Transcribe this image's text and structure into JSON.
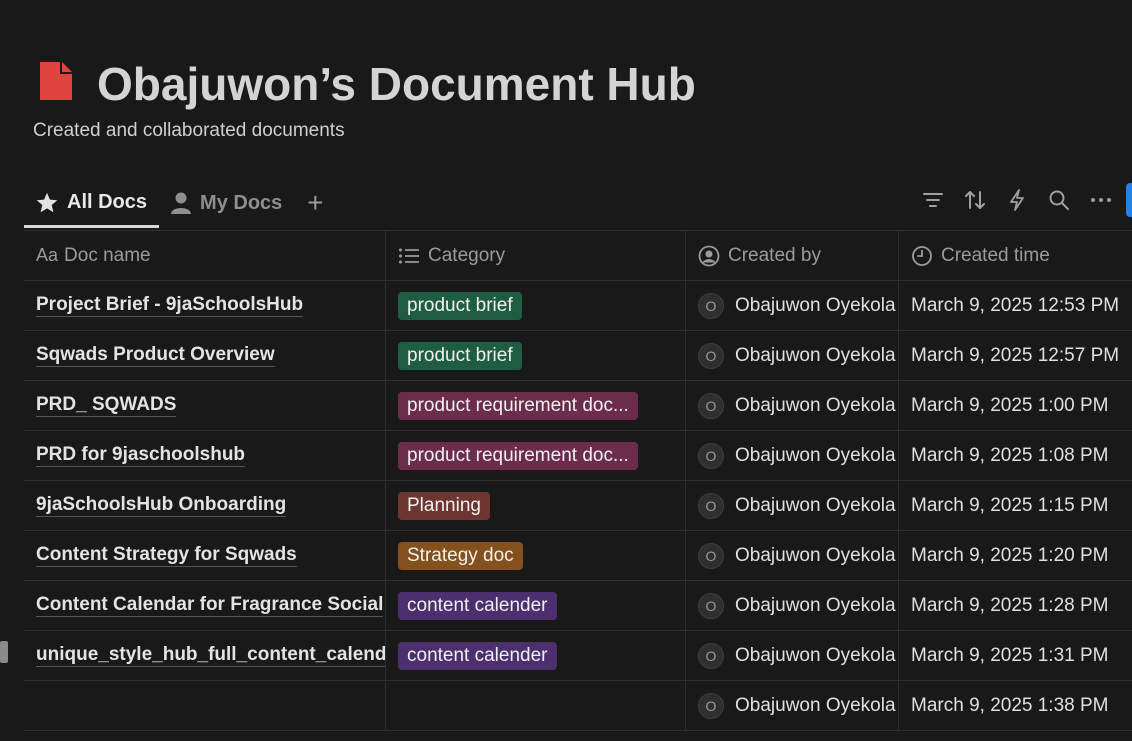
{
  "page": {
    "title": "Obajuwon’s Document Hub",
    "subtitle": "Created and collaborated documents",
    "icon": "document-icon",
    "icon_color": "#e0443f"
  },
  "tabs": [
    {
      "label": "All Docs",
      "icon": "star-icon",
      "active": true
    },
    {
      "label": "My Docs",
      "icon": "person-icon",
      "active": false
    }
  ],
  "add_tab_label": "+",
  "toolbar": [
    "filter-icon",
    "sort-icon",
    "automation-icon",
    "search-icon",
    "more-icon"
  ],
  "columns": [
    {
      "label": "Doc name",
      "prefix": "Aa"
    },
    {
      "label": "Category",
      "icon": "list-icon"
    },
    {
      "label": "Created by",
      "icon": "user-circle-icon"
    },
    {
      "label": "Created time",
      "icon": "clock-icon"
    }
  ],
  "tag_colors": {
    "product brief": "#1f5d42",
    "product requirement doc...": "#6c2d4d",
    "Planning": "#6e3630",
    "Strategy doc": "#84501b",
    "content calender": "#4b2f6e"
  },
  "rows": [
    {
      "name": "Project Brief - 9jaSchoolsHub",
      "category": "product brief",
      "avatar": "O",
      "created_by": "Obajuwon Oyekola",
      "created_time": "March 9, 2025 12:53 PM"
    },
    {
      "name": "Sqwads Product Overview",
      "category": "product brief",
      "avatar": "O",
      "created_by": "Obajuwon Oyekola",
      "created_time": "March 9, 2025 12:57 PM"
    },
    {
      "name": "PRD_ SQWADS",
      "category": "product requirement doc...",
      "avatar": "O",
      "created_by": "Obajuwon Oyekola",
      "created_time": "March 9, 2025 1:00 PM"
    },
    {
      "name": "PRD for 9jaschoolshub",
      "category": "product requirement doc...",
      "avatar": "O",
      "created_by": "Obajuwon Oyekola",
      "created_time": "March 9, 2025 1:08 PM"
    },
    {
      "name": "9jaSchoolsHub Onboarding",
      "category": "Planning",
      "avatar": "O",
      "created_by": "Obajuwon Oyekola",
      "created_time": "March 9, 2025 1:15 PM"
    },
    {
      "name": "Content Strategy for Sqwads",
      "category": "Strategy doc",
      "avatar": "O",
      "created_by": "Obajuwon Oyekola",
      "created_time": "March 9, 2025 1:20 PM"
    },
    {
      "name": "Content Calendar for Fragrance Social",
      "category": "content calender",
      "avatar": "O",
      "created_by": "Obajuwon Oyekola",
      "created_time": "March 9, 2025 1:28 PM"
    },
    {
      "name": "unique_style_hub_full_content_calendar",
      "category": "content calender",
      "avatar": "O",
      "created_by": "Obajuwon Oyekola",
      "created_time": "March 9, 2025 1:31 PM"
    },
    {
      "name": "",
      "category": "",
      "avatar": "O",
      "created_by": "Obajuwon Oyekola",
      "created_time": "March 9, 2025 1:38 PM"
    }
  ]
}
